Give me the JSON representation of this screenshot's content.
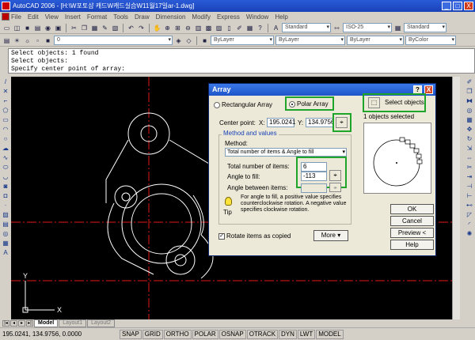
{
  "window": {
    "title": "AutoCAD 2006 - [H:\\W포토샵 캐드W캐드실습W11월17일ar-1.dwg]",
    "min": "_",
    "max": "□",
    "close": "X"
  },
  "menu": [
    "File",
    "Edit",
    "View",
    "Insert",
    "Format",
    "Tools",
    "Draw",
    "Dimension",
    "Modify",
    "Express",
    "Window",
    "Help"
  ],
  "toolbar": {
    "text_style": "Standard",
    "dim_style": "ISO-25",
    "table_style": "Standard",
    "layer": "0",
    "color": "ByLayer",
    "linetype": "ByLayer",
    "lineweight": "ByLayer",
    "plotstyle": "ByColor"
  },
  "command": {
    "lines": [
      "Select objects: 1 found",
      "Select objects:",
      "Specify center point of array:"
    ]
  },
  "tabs": [
    "Model",
    "Layout1",
    "Layout2"
  ],
  "status": {
    "coords": "195.0241, 134.9756, 0.0000",
    "toggles": [
      "SNAP",
      "GRID",
      "ORTHO",
      "POLAR",
      "OSNAP",
      "OTRACK",
      "DYN",
      "LWT",
      "MODEL"
    ]
  },
  "dialog": {
    "title": "Array",
    "help": "?",
    "close": "X",
    "rect_label": "Rectangular Array",
    "polar_label": "Polar Array",
    "select_label": "Select objects",
    "selected_text": "1 objects selected",
    "center_label": "Center point:",
    "x_label": "X:",
    "x_value": "195.0241",
    "y_label": "Y:",
    "y_value": "134.9756",
    "method_group": "Method and values",
    "method_label": "Method:",
    "method_value": "Total number of items & Angle to fill",
    "total_label": "Total number of items:",
    "total_value": "6",
    "fill_label": "Angle to fill:",
    "fill_value": "-113",
    "between_label": "Angle between items:",
    "between_value": "",
    "tip_label": "Tip",
    "tip_text": "For angle to fill, a positive value specifies counterclockwise rotation.  A negative value specifies clockwise rotation.",
    "rotate_label": "Rotate items as copied",
    "more_label": "More",
    "ok": "OK",
    "cancel": "Cancel",
    "preview": "Preview <",
    "helpbtn": "Help"
  },
  "axis": {
    "x": "X",
    "y": "Y"
  },
  "colors": {
    "highlight": "#1fa52a",
    "drawing_bg": "#000000",
    "construction": "#e01818",
    "geometry": "#ffffff"
  }
}
